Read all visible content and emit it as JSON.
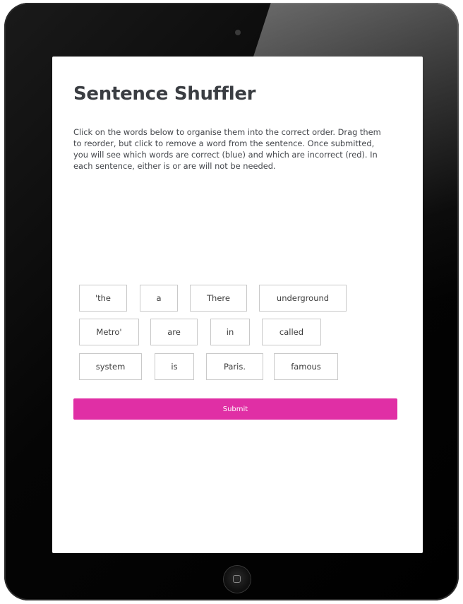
{
  "app": {
    "title": "Sentence Shuffler",
    "instructions": "Click on the words below to organise them into the correct order. Drag them to reorder, but click to remove a word from the sentence. Once submitted, you will see which words are correct (blue) and which are incorrect (red). In each sentence, either is or are will not be needed."
  },
  "words": {
    "w1": "'the",
    "w2": "a",
    "w3": "There",
    "w4": "underground",
    "w5": "Metro'",
    "w6": "are",
    "w7": "in",
    "w8": "called",
    "w9": "system",
    "w10": "is",
    "w11": "Paris.",
    "w12": "famous"
  },
  "actions": {
    "submit_label": "Submit"
  },
  "colors": {
    "accent": "#e02fa5",
    "word_border": "#c9c9c9",
    "device_frame": "#000000"
  }
}
